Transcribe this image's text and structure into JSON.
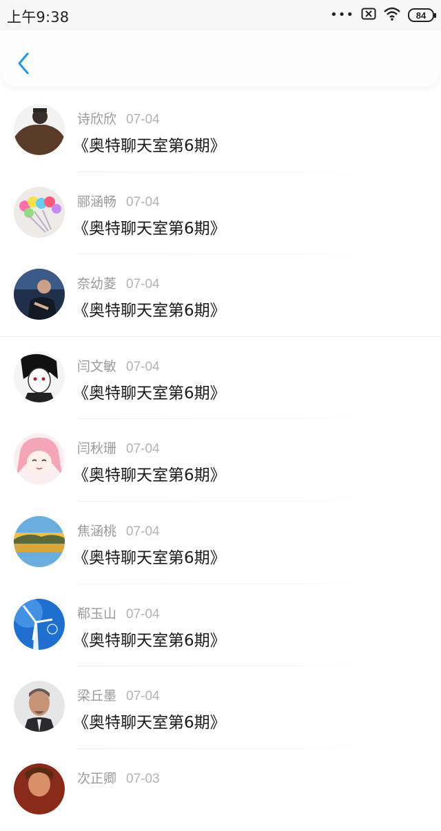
{
  "status_bar": {
    "time": "上午9:38",
    "battery": "84",
    "icons": [
      "more-dots-icon",
      "sim-off-icon",
      "wifi-icon",
      "battery-icon"
    ]
  },
  "nav": {
    "back_icon": "chevron-left-icon",
    "accent": "#1e96f0"
  },
  "list": {
    "items": [
      {
        "name": "诗欣欣",
        "date": "07-04",
        "title": "《奥特聊天室第6期》"
      },
      {
        "name": "郦涵畅",
        "date": "07-04",
        "title": "《奥特聊天室第6期》"
      },
      {
        "name": "奈幼菱",
        "date": "07-04",
        "title": "《奥特聊天室第6期》"
      },
      {
        "name": "闫文敏",
        "date": "07-04",
        "title": "《奥特聊天室第6期》"
      },
      {
        "name": "闫秋珊",
        "date": "07-04",
        "title": "《奥特聊天室第6期》"
      },
      {
        "name": "焦涵桃",
        "date": "07-04",
        "title": "《奥特聊天室第6期》"
      },
      {
        "name": "郗玉山",
        "date": "07-04",
        "title": "《奥特聊天室第6期》"
      },
      {
        "name": "梁丘墨",
        "date": "07-04",
        "title": "《奥特聊天室第6期》"
      },
      {
        "name": "次正卿",
        "date": "07-03",
        "title": ""
      }
    ]
  }
}
